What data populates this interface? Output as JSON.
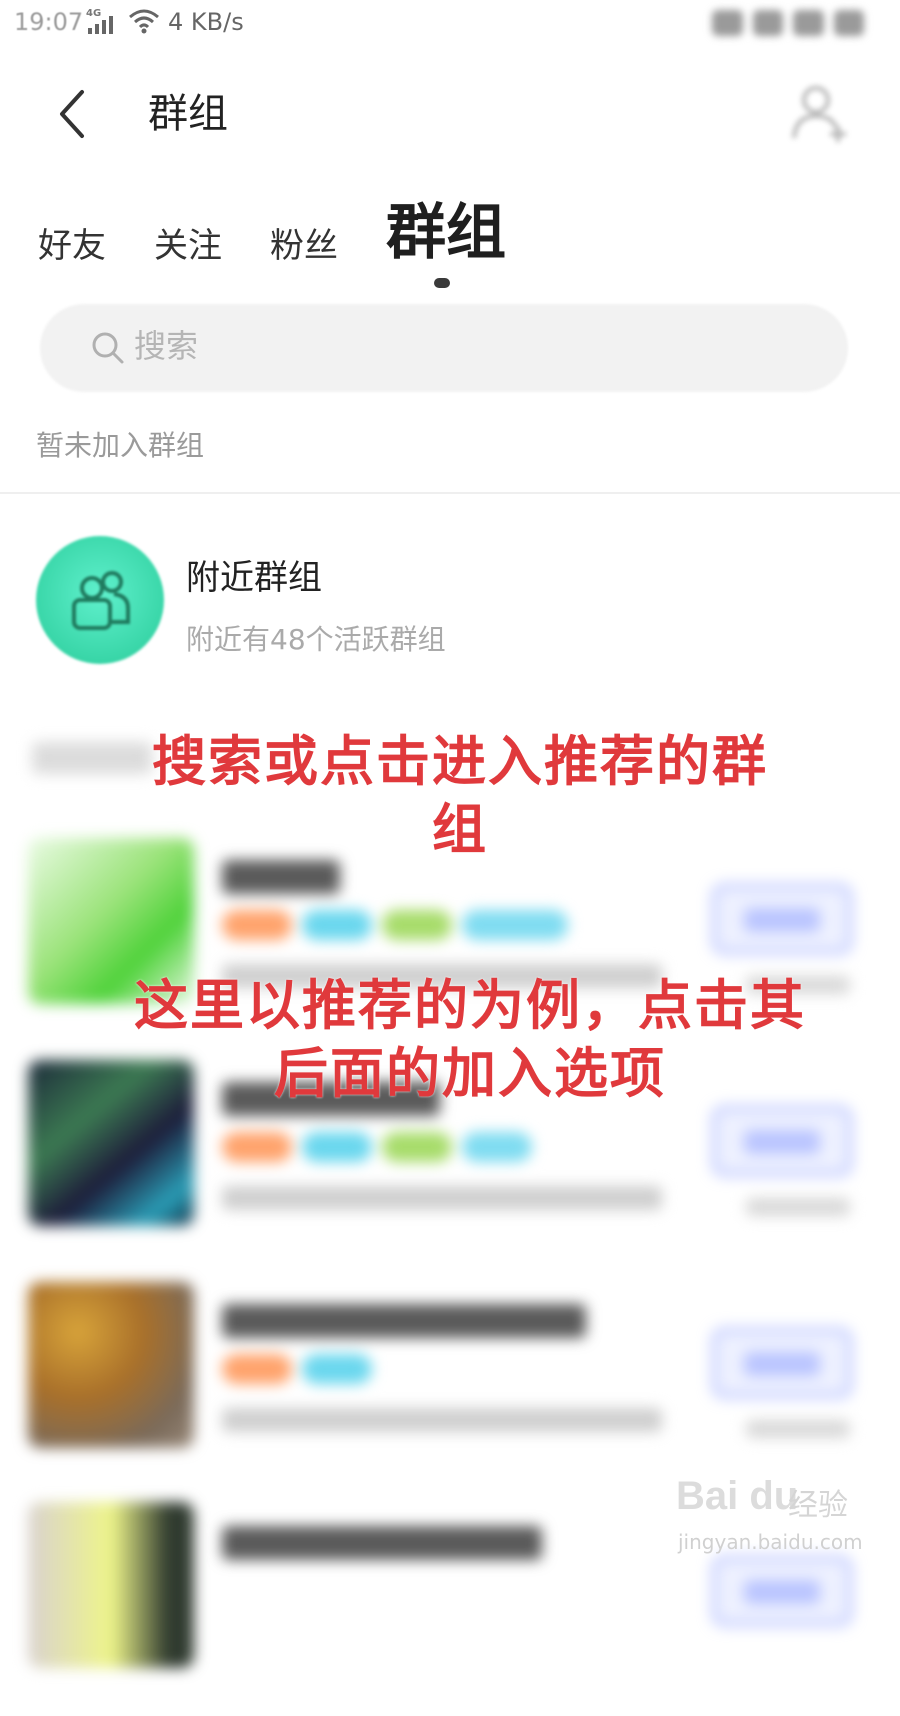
{
  "status_bar": {
    "time": "19:07",
    "network": "4G",
    "speed": "4 KB/s"
  },
  "header": {
    "title": "群组"
  },
  "tabs": [
    {
      "label": "好友",
      "active": false
    },
    {
      "label": "关注",
      "active": false
    },
    {
      "label": "粉丝",
      "active": false
    },
    {
      "label": "群组",
      "active": true
    }
  ],
  "search": {
    "placeholder": "搜索"
  },
  "empty_hint": "暂未加入群组",
  "nearby": {
    "title": "附近群组",
    "subtitle": "附近有48个活跃群组"
  },
  "annotations": {
    "note1": "搜索或点击进入推荐的群组",
    "note2": "这里以推荐的为例，点击其后面的加入选项"
  },
  "watermark": {
    "logo": "Bai du",
    "brand_cn": "经验",
    "url": "jingyan.baidu.com"
  },
  "colors": {
    "accent": "#39d6a8",
    "annotation": "#e0393c",
    "join_button": "#a7b4ff"
  }
}
